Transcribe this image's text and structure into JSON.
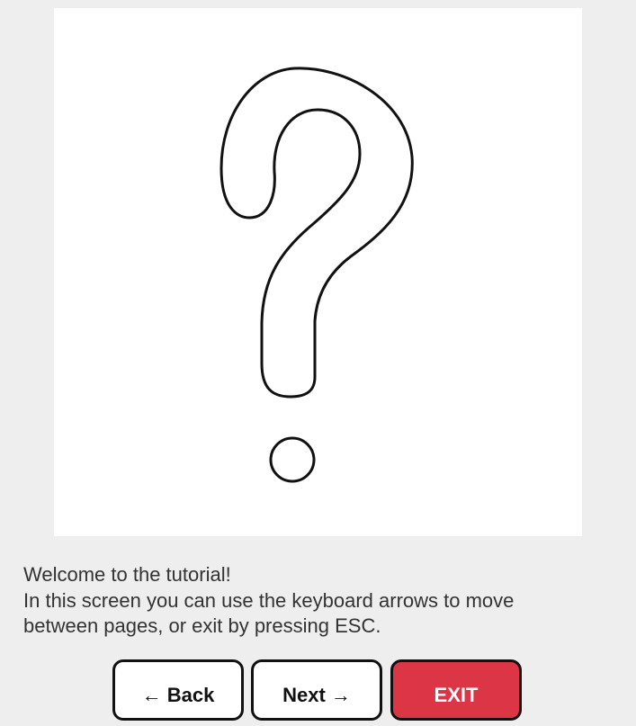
{
  "illustration": {
    "icon": "question-mark-icon"
  },
  "message": {
    "line1": "Welcome to the tutorial!",
    "line2": "In this screen you can use the keyboard arrows to move",
    "line3": "between pages, or exit by pressing ESC."
  },
  "buttons": {
    "back_label": "← Back",
    "next_label": "Next →",
    "exit_label": "EXIT"
  },
  "colors": {
    "page_background": "#eeeeee",
    "panel_background": "#ffffff",
    "exit_button": "#dc3545"
  }
}
